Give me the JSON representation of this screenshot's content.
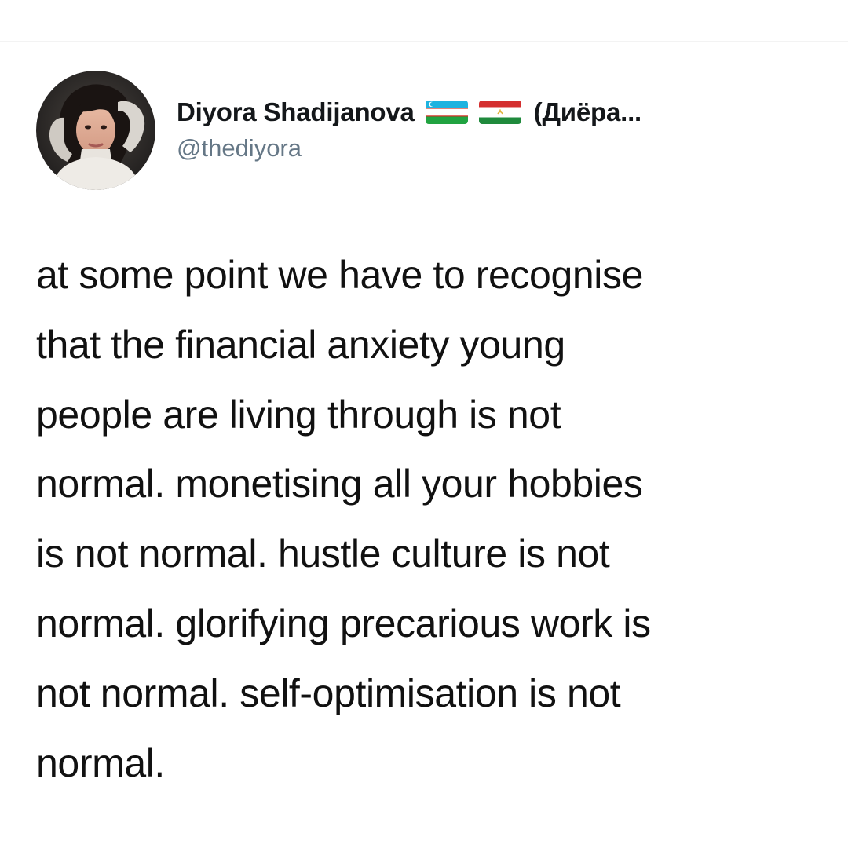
{
  "tweet": {
    "author": {
      "display_name": "Diyora Shadijanova",
      "native_name": "(Диёра...",
      "handle": "@thediyora",
      "flags": [
        "uzbekistan-flag-icon",
        "tajikistan-flag-icon"
      ]
    },
    "text_lines": [
      "at some point we have to recognise",
      "that the financial anxiety young",
      "people are living through is not",
      "normal. monetising all your hobbies",
      "is not normal. hustle culture is not",
      "normal. glorifying precarious work is",
      "not normal. self-optimisation is not",
      "normal."
    ]
  },
  "colors": {
    "background": "#ffffff",
    "name": "#14171a",
    "handle": "#657786",
    "text": "#111111"
  }
}
